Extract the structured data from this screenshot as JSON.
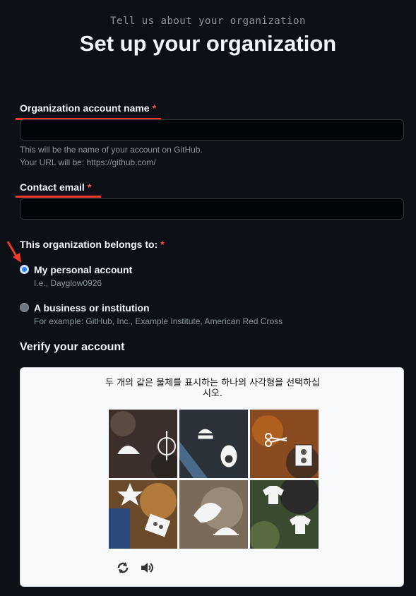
{
  "header": {
    "subtitle": "Tell us about your organization",
    "title": "Set up your organization"
  },
  "form": {
    "org_name": {
      "label": "Organization account name",
      "required_mark": "*",
      "value": "",
      "hint_line1": "This will be the name of your account on GitHub.",
      "hint_line2": "Your URL will be: https://github.com/"
    },
    "contact_email": {
      "label": "Contact email",
      "required_mark": "*",
      "value": ""
    },
    "belongs_to": {
      "label": "This organization belongs to:",
      "required_mark": "*",
      "options": [
        {
          "label": "My personal account",
          "hint": "I.e., Dayglow0926",
          "checked": true
        },
        {
          "label": "A business or institution",
          "hint": "For example: GitHub, Inc., Example Institute, American Red Cross",
          "checked": false
        }
      ]
    }
  },
  "verify": {
    "title": "Verify your account",
    "instruction": "두 개의 같은 물체를 표시하는 하나의 사각형을 선택하십시오.",
    "tiles": [
      {
        "icons": [
          "hamburger-icon",
          "scale-icon"
        ]
      },
      {
        "icons": [
          "hamburger-icon",
          "avocado-icon"
        ]
      },
      {
        "icons": [
          "scissors-icon",
          "cassette-icon"
        ]
      },
      {
        "icons": [
          "star-icon",
          "cassette-icon"
        ]
      },
      {
        "icons": [
          "wing-icon",
          "cloche-icon"
        ]
      },
      {
        "icons": [
          "shirt-icon",
          "shirt-icon"
        ]
      }
    ],
    "tools": [
      "refresh-icon",
      "audio-icon"
    ]
  },
  "colors": {
    "background": "#0d1117",
    "annotation_red": "#f0392b",
    "required": "#f85149",
    "radio_checked": "#2f81f7"
  }
}
